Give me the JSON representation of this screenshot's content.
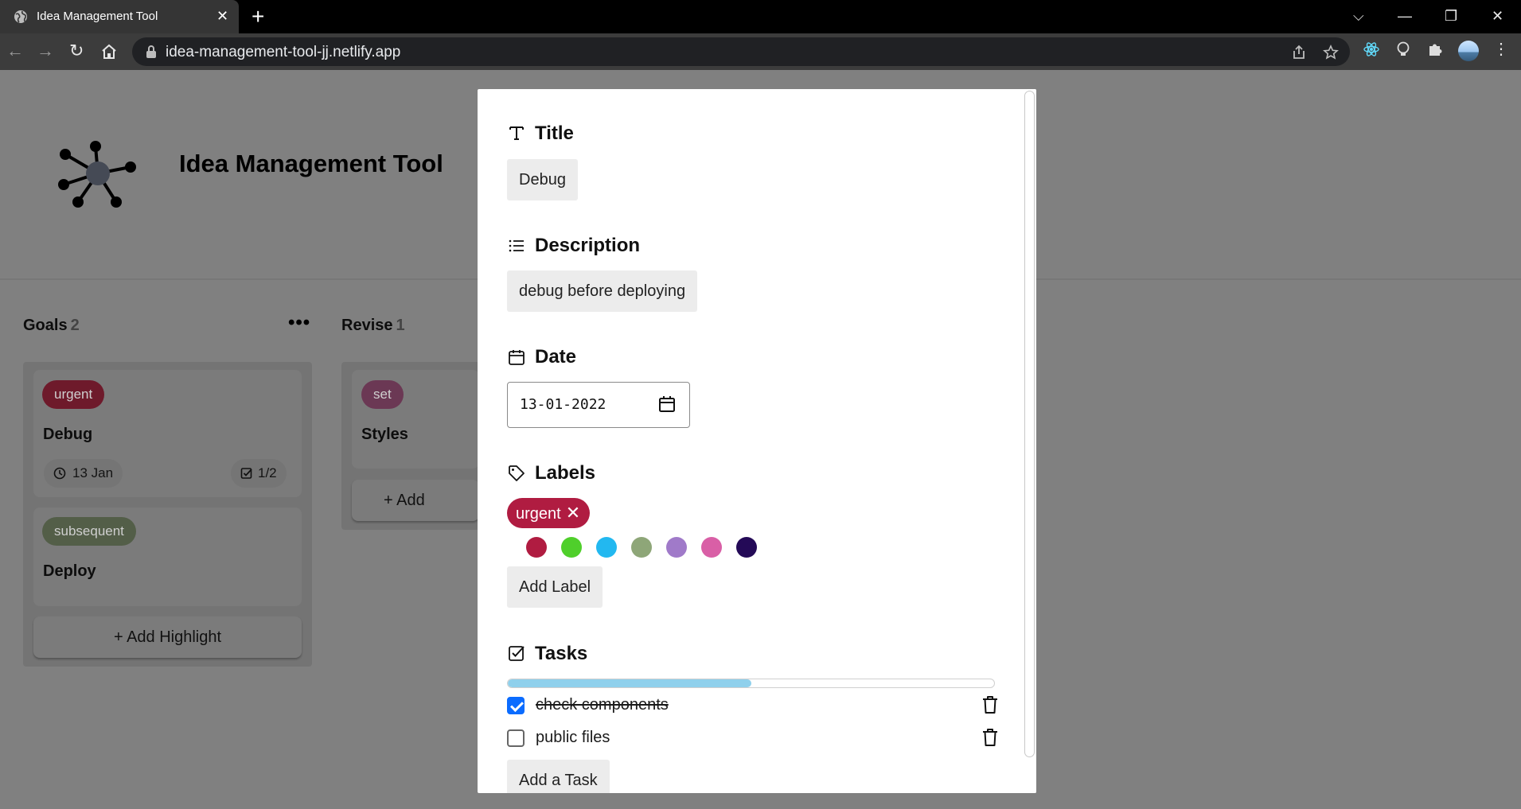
{
  "browser": {
    "tab_title": "Idea Management Tool",
    "tab_close": "✕",
    "new_tab": "+",
    "url": "idea-management-tool-jj.netlify.app",
    "window_controls": {
      "dropdown": "⌵",
      "minimize": "—",
      "restore": "❐",
      "close": "✕"
    },
    "nav": {
      "back": "←",
      "forward": "→",
      "reload": "↻"
    },
    "menu": "⋮"
  },
  "app": {
    "title": "Idea Management Tool",
    "columns": [
      {
        "title": "Goals",
        "count": "2",
        "menu": "•••",
        "cards": [
          {
            "label": "urgent",
            "label_color": "#6e1a2b",
            "title": "Debug",
            "date": "13 Jan",
            "tasks": "1/2"
          },
          {
            "label": "subsequent",
            "label_color": "#535e48",
            "title": "Deploy"
          }
        ],
        "add_button": "+ Add Highlight"
      },
      {
        "title": "Revise",
        "count": "1",
        "cards": [
          {
            "label": "set",
            "label_color": "#6b3854",
            "title": "Styles"
          }
        ],
        "add_button": "+ Add"
      }
    ]
  },
  "modal": {
    "title_section": {
      "heading": "Title",
      "value": "Debug"
    },
    "description_section": {
      "heading": "Description",
      "value": "debug before deploying"
    },
    "date_section": {
      "heading": "Date",
      "value": "13-01-2022"
    },
    "labels_section": {
      "heading": "Labels",
      "active_label": "urgent",
      "active_label_remove": "✕",
      "swatches": [
        "#b01c41",
        "#4fcf2b",
        "#22b8f0",
        "#8ea678",
        "#a07ac9",
        "#d95fa6",
        "#240a57"
      ],
      "add_button": "Add Label"
    },
    "tasks_section": {
      "heading": "Tasks",
      "progress_fraction": 0.5,
      "tasks": [
        {
          "text": "check components",
          "done": true
        },
        {
          "text": "public files",
          "done": false
        }
      ],
      "add_button": "Add a Task"
    }
  }
}
